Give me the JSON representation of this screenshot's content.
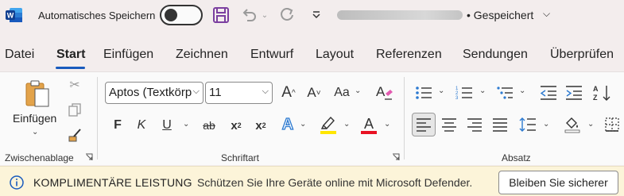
{
  "titlebar": {
    "autosave_label": "Automatisches Speichern",
    "saved_status": "• Gespeichert"
  },
  "tabs": [
    "Datei",
    "Start",
    "Einfügen",
    "Zeichnen",
    "Entwurf",
    "Layout",
    "Referenzen",
    "Sendungen",
    "Überprüfen"
  ],
  "ribbon": {
    "clipboard": {
      "paste_label": "Einfügen",
      "group_label": "Zwischenablage"
    },
    "font": {
      "font_name": "Aptos (Textkörp",
      "font_size": "11",
      "group_label": "Schriftart",
      "case_label": "Aa"
    },
    "paragraph": {
      "group_label": "Absatz"
    }
  },
  "infobar": {
    "title": "KOMPLIMENTÄRE LEISTUNG",
    "message": "Schützen Sie Ihre Geräte online mit Microsoft Defender.",
    "button": "Bleiben Sie sicherer"
  },
  "colors": {
    "accent": "#185abd",
    "highlight": "#ffe600",
    "font_color": "#e81123",
    "save_purple": "#7b3fa0"
  }
}
